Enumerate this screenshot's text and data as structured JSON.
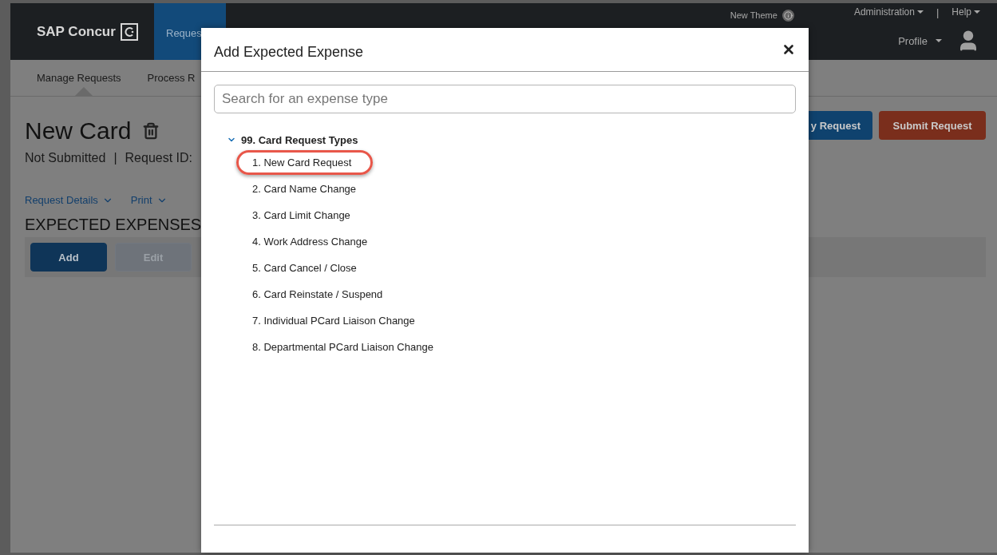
{
  "header": {
    "logo": "SAP Concur",
    "tabs": [
      {
        "label": "Reques",
        "selected": true
      }
    ],
    "theme_link": "New Theme",
    "menus": [
      "Administration",
      "Help"
    ],
    "separator": "|",
    "profile": "Profile"
  },
  "subnav": {
    "items": [
      {
        "label": "Manage Requests",
        "selected": true
      },
      {
        "label": "Process R",
        "selected": false
      }
    ]
  },
  "request": {
    "title": "New Card",
    "status": "Not Submitted",
    "separator": "|",
    "id_label": "Request ID:",
    "actions": [
      "Request Details",
      "Print"
    ],
    "section": "EXPECTED EXPENSES",
    "toolbar": [
      {
        "label": "Add",
        "disabled": false
      },
      {
        "label": "Edit",
        "disabled": true
      }
    ],
    "buttons": [
      {
        "label": "y Request",
        "kind": "primary"
      },
      {
        "label": "Submit Request",
        "kind": "submit"
      }
    ]
  },
  "dialog": {
    "title": "Add Expected Expense",
    "search": {
      "placeholder": "Search for an expense type"
    },
    "tree": [
      {
        "label": "99. Card Request Types",
        "expanded": true,
        "children": [
          {
            "label": "1. New Card Request",
            "selected": true
          },
          {
            "label": "2. Card Name Change",
            "selected": false
          },
          {
            "label": "3. Card Limit Change",
            "selected": false
          },
          {
            "label": "4. Work Address Change",
            "selected": false
          },
          {
            "label": "5. Card Cancel / Close",
            "selected": false
          },
          {
            "label": "6. Card Reinstate / Suspend",
            "selected": false
          },
          {
            "label": "7. Individual PCard Liaison Change",
            "selected": false
          },
          {
            "label": "8. Departmental PCard Liaison Change",
            "selected": false
          }
        ]
      }
    ]
  }
}
